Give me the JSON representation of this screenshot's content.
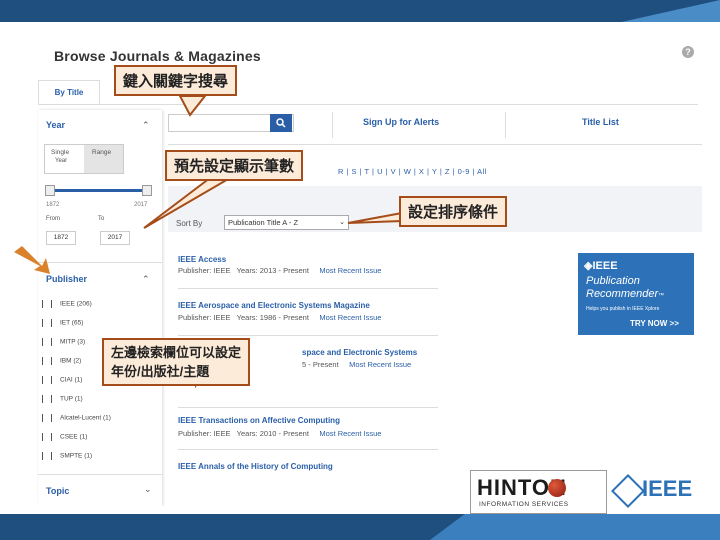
{
  "page": {
    "title": "Browse Journals & Magazines",
    "help": "?"
  },
  "tabs": {
    "by_title": "By Title"
  },
  "sidebar": {
    "year": {
      "heading": "Year",
      "single_label": "Single",
      "single_sub": "Year",
      "range_label": "Range",
      "slider_min": "1872",
      "slider_max": "2017",
      "from_label": "From",
      "to_label": "To",
      "from_value": "1872",
      "to_value": "2017"
    },
    "publisher": {
      "heading": "Publisher",
      "items": [
        {
          "label": "IEEE (206)"
        },
        {
          "label": "IET (65)"
        },
        {
          "label": "MITP (3)"
        },
        {
          "label": "IBM (2)"
        },
        {
          "label": "CIAI (1)"
        },
        {
          "label": "TUP (1)"
        },
        {
          "label": "Alcatel-Lucent (1)"
        },
        {
          "label": "CSEE (1)"
        },
        {
          "label": "SMPTE (1)"
        }
      ]
    },
    "topic": {
      "heading": "Topic"
    }
  },
  "toolbar": {
    "search_icon": "magnifier-icon",
    "signup_alerts": "Sign Up for Alerts",
    "title_list": "Title List",
    "alphabet": "R | S | T | U | V | W | X | Y | Z | 0-9 | All",
    "sort_label": "Sort By",
    "sort_value": "Publication Title A - Z"
  },
  "results": [
    {
      "title": "IEEE Access",
      "publisher": "Publisher: IEEE",
      "years": "Years: 2013 - Present",
      "issue": "Most Recent Issue"
    },
    {
      "title": "IEEE Aerospace and Electronic Systems Magazine",
      "publisher": "Publisher: IEEE",
      "years": "Years: 1986 - Present",
      "issue": "Most Recent Issue"
    },
    {
      "title": "space and Electronic Systems",
      "publisher": "",
      "years": "5 - Present",
      "issue": "Most Recent Issue"
    },
    {
      "title": "IEEE Transactions on Affective Computing",
      "publisher": "Publisher: IEEE",
      "years": "Years: 2010 - Present",
      "issue": "Most Recent Issue"
    },
    {
      "title": "IEEE Annals of the History of Computing",
      "publisher": "",
      "years": "",
      "issue": ""
    }
  ],
  "ad": {
    "brand": "IEEE",
    "line1": "Publication",
    "line2": "Recommender",
    "tm": "™",
    "tagline": "Helps you publish in IEEE Xplore",
    "cta": "TRY NOW >>"
  },
  "callouts": {
    "keyword_search": "鍵入關鍵字搜尋",
    "display_count": "預先設定顯示筆數",
    "sort_condition": "設定排序條件",
    "left_fields_line1": "左邊檢索欄位可以設定",
    "left_fields_line2": "年份/出版社/主題"
  },
  "logos": {
    "hinton": "HINTON",
    "hinton_sub": "INFORMATION SERVICES",
    "ieee": "IEEE"
  },
  "colors": {
    "brand_blue": "#1f4f7f",
    "link_blue": "#2a5fa8",
    "callout_fill": "#fdebd9",
    "callout_border": "#a54d1a",
    "arrow_orange": "#d9822b"
  }
}
